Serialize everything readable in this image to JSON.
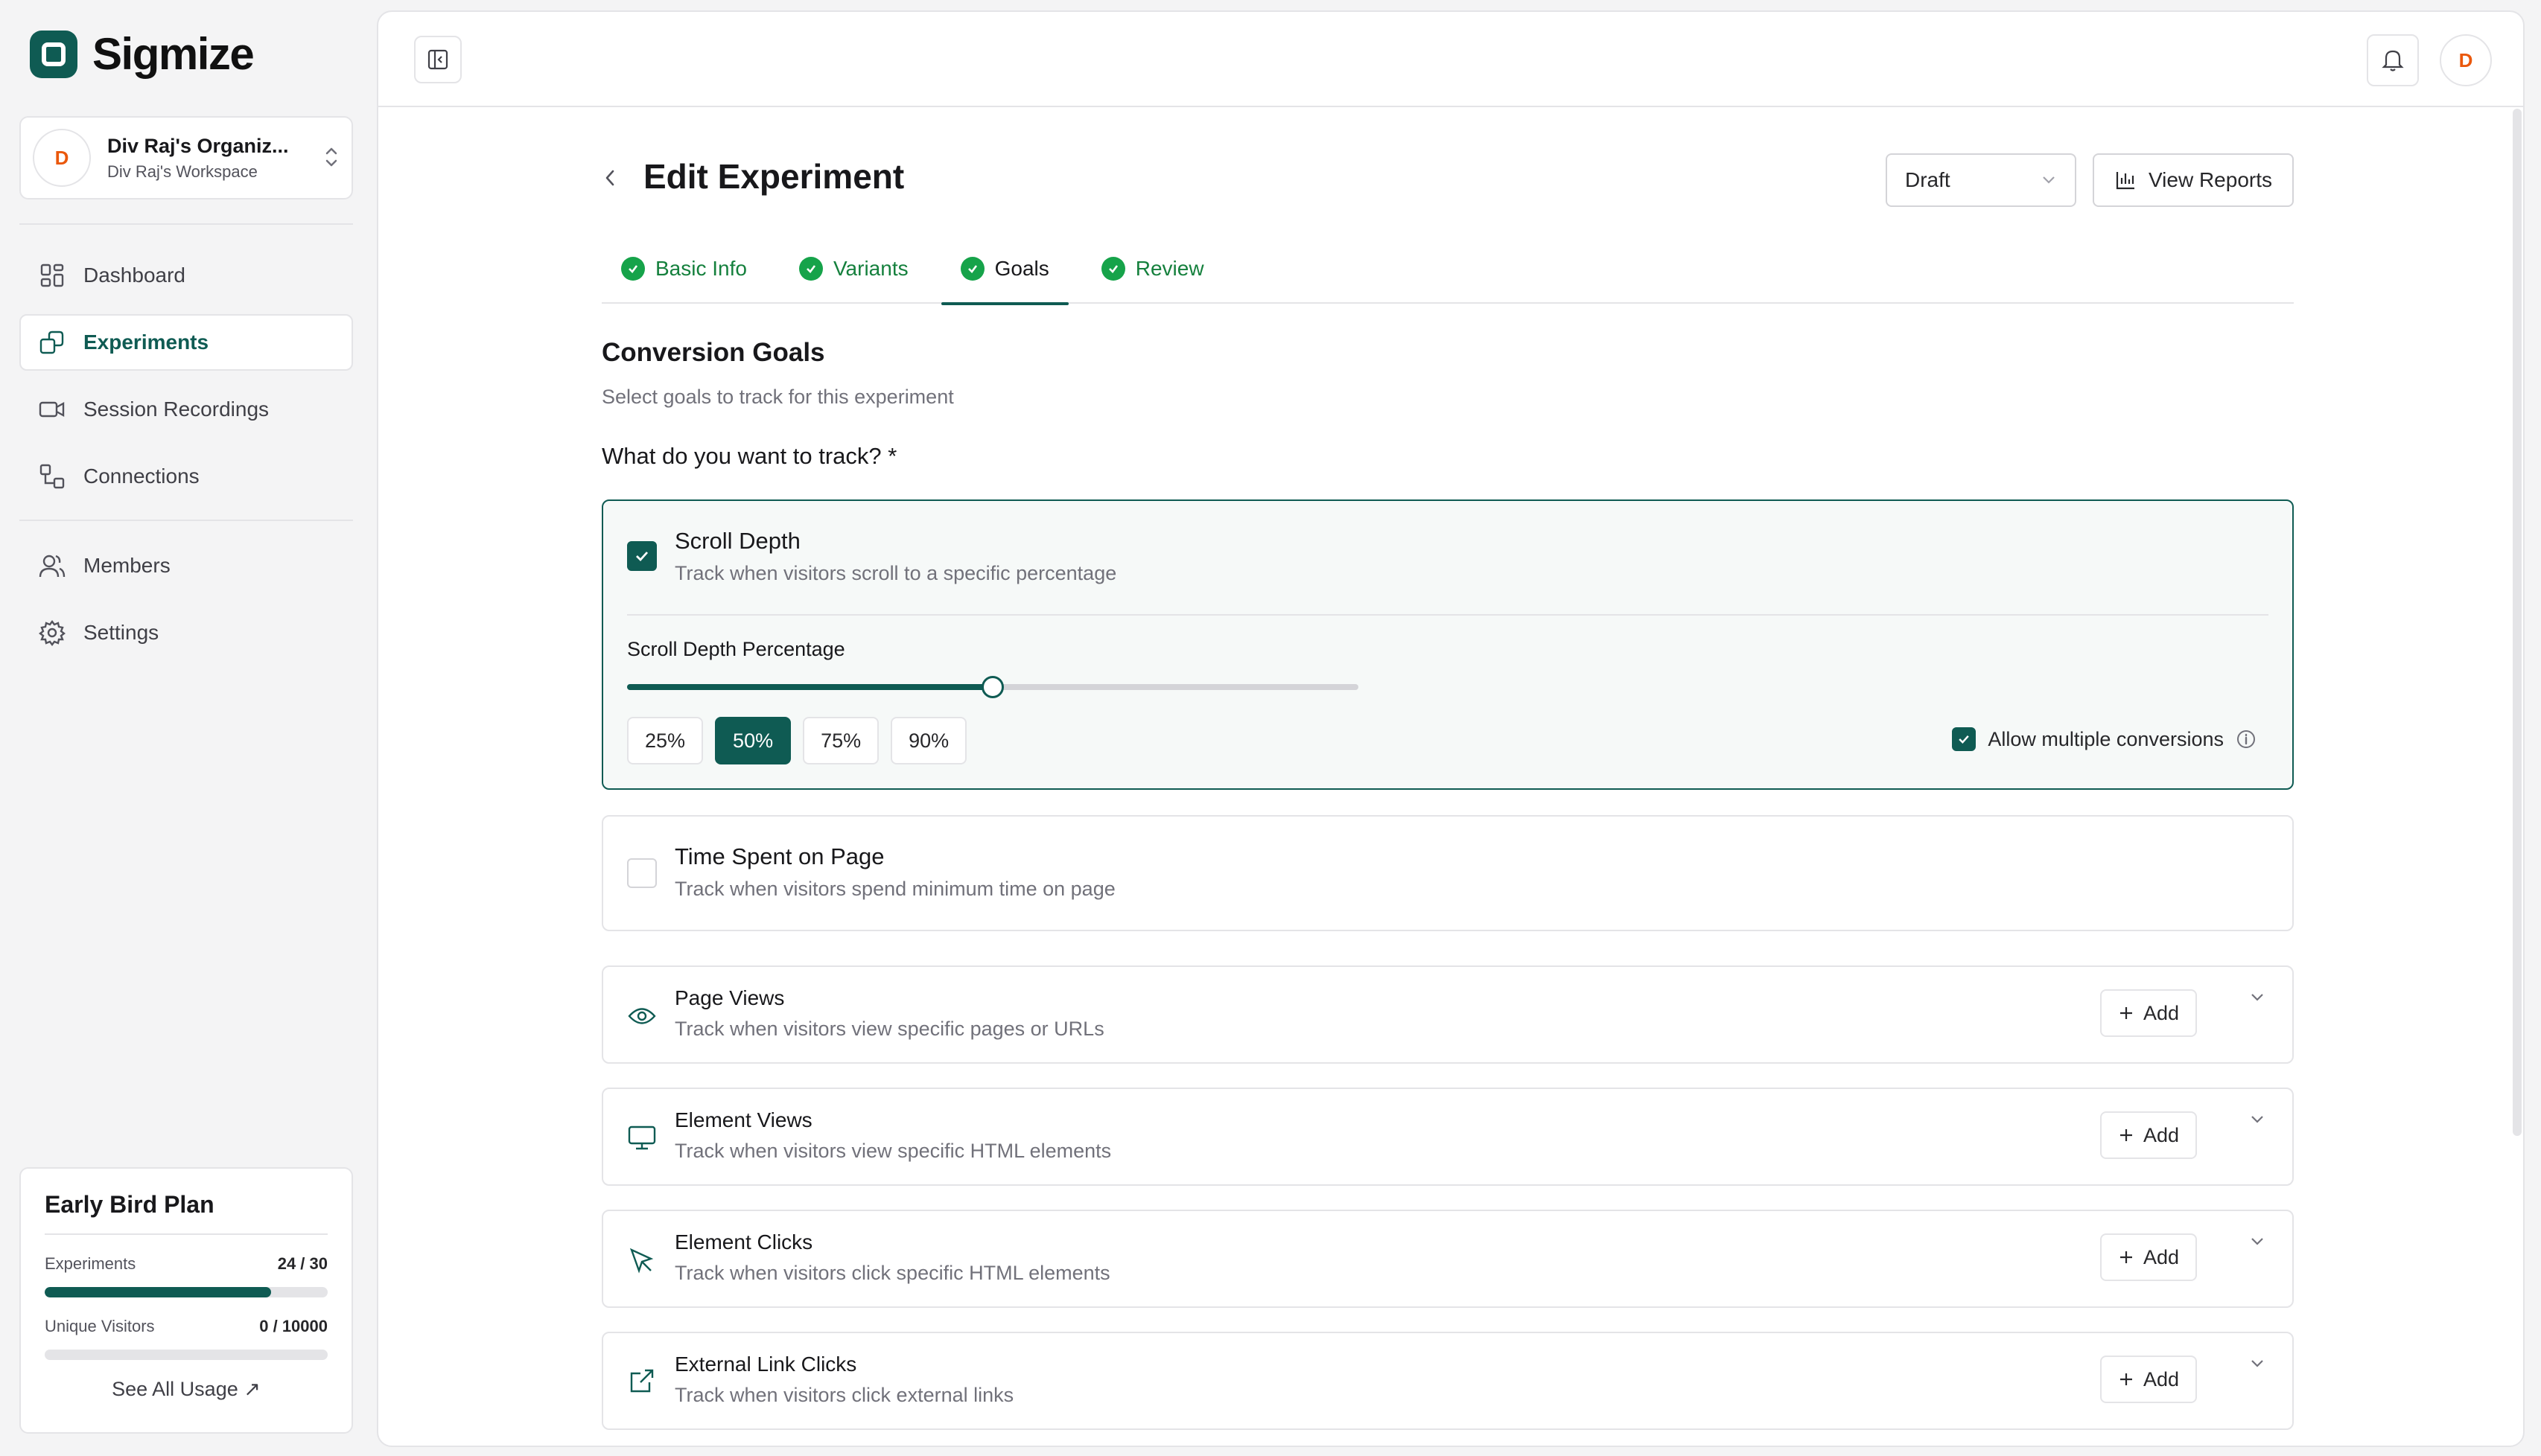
{
  "brand": {
    "name": "Sigmize"
  },
  "org": {
    "initial": "D",
    "name": "Div Raj's Organiz...",
    "workspace": "Div Raj's Workspace"
  },
  "nav": {
    "primary": [
      {
        "label": "Dashboard",
        "icon": "dashboard-icon"
      },
      {
        "label": "Experiments",
        "icon": "experiments-icon",
        "active": true
      },
      {
        "label": "Session Recordings",
        "icon": "video-icon"
      },
      {
        "label": "Connections",
        "icon": "connections-icon"
      }
    ],
    "secondary": [
      {
        "label": "Members",
        "icon": "users-icon"
      },
      {
        "label": "Settings",
        "icon": "gear-icon"
      }
    ]
  },
  "plan": {
    "title": "Early Bird Plan",
    "experiments_label": "Experiments",
    "experiments_value": "24 / 30",
    "experiments_fraction": 0.8,
    "visitors_label": "Unique Visitors",
    "visitors_value": "0 / 10000",
    "visitors_fraction": 0,
    "link": "See All Usage ↗"
  },
  "topbar": {
    "user_initial": "D"
  },
  "page": {
    "title": "Edit Experiment",
    "status": "Draft",
    "reports_label": "View Reports"
  },
  "tabs": [
    {
      "label": "Basic Info",
      "done": true
    },
    {
      "label": "Variants",
      "done": true
    },
    {
      "label": "Goals",
      "done": true,
      "current": true
    },
    {
      "label": "Review",
      "done": true
    }
  ],
  "goals_section": {
    "title": "Conversion Goals",
    "subtitle": "Select goals to track for this experiment",
    "question": "What do you want to track? *"
  },
  "scroll_goal": {
    "title": "Scroll Depth",
    "desc": "Track when visitors scroll to a specific percentage",
    "checked": true,
    "slider_label": "Scroll Depth Percentage",
    "slider_value": 50,
    "presets": [
      "25%",
      "50%",
      "75%",
      "90%"
    ],
    "active_preset": "50%",
    "multiple_label": "Allow multiple conversions",
    "multiple_checked": true
  },
  "time_goal": {
    "title": "Time Spent on Page",
    "desc": "Track when visitors spend minimum time on page",
    "checked": false
  },
  "add_label": "Add",
  "event_goals": [
    {
      "title": "Page Views",
      "desc": "Track when visitors view specific pages or URLs",
      "icon": "eye-icon"
    },
    {
      "title": "Element Views",
      "desc": "Track when visitors view specific HTML elements",
      "icon": "monitor-icon"
    },
    {
      "title": "Element Clicks",
      "desc": "Track when visitors click specific HTML elements",
      "icon": "cursor-icon"
    },
    {
      "title": "External Link Clicks",
      "desc": "Track when visitors click external links",
      "icon": "external-link-icon"
    }
  ],
  "colors": {
    "brand": "#0f5b53",
    "success": "#16a34a",
    "avatar": "#ea580c"
  }
}
